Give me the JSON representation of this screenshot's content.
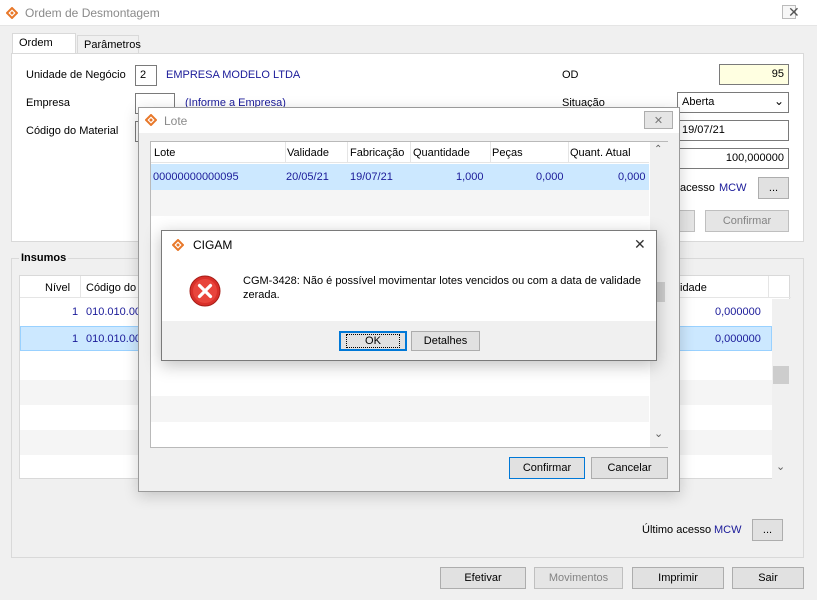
{
  "window": {
    "title": "Ordem de Desmontagem"
  },
  "tabs": [
    {
      "label": "Ordem"
    },
    {
      "label": "Parâmetros"
    }
  ],
  "form": {
    "unidade_label": "Unidade de Negócio",
    "unidade_code": "2",
    "unidade_name": "EMPRESA MODELO LTDA",
    "empresa_label": "Empresa",
    "empresa_hint": "(Informe a Empresa)",
    "codigo_material_label": "Código do Material",
    "od_label": "OD",
    "od_value": "95",
    "situacao_label": "Situação",
    "situacao_value": "Aberta",
    "date_value": "19/07/21",
    "quantity_value": "100,000000",
    "ultimo_acesso_label": "Último acesso",
    "ultimo_acesso_partial": "acesso",
    "ultimo_acesso_user": "MCW",
    "ellipsis": "...",
    "confirmar_label": "Confirmar"
  },
  "insumos": {
    "title": "Insumos",
    "columns": {
      "nivel": "Nível",
      "codigo": "Código do",
      "quantidade": "idade"
    },
    "rows": [
      {
        "nivel": "1",
        "codigo": "010.010.00",
        "quantidade": "0,000000"
      },
      {
        "nivel": "1",
        "codigo": "010.010.00",
        "quantidade": "0,000000"
      }
    ],
    "ultimo_acesso_label": "Último acesso",
    "ultimo_acesso_user": "MCW",
    "ellipsis": "..."
  },
  "footer": {
    "efetivar": "Efetivar",
    "movimentos": "Movimentos",
    "imprimir": "Imprimir",
    "sair": "Sair"
  },
  "lote_dialog": {
    "title": "Lote",
    "columns": [
      "Lote",
      "Validade",
      "Fabricação",
      "Quantidade",
      "Peças",
      "Quant. Atual"
    ],
    "rows": [
      {
        "lote": "00000000000095",
        "validade": "20/05/21",
        "fabricacao": "19/07/21",
        "quantidade": "1,000",
        "pecas": "0,000",
        "quant_atual": "0,000"
      }
    ],
    "confirmar": "Confirmar",
    "cancelar": "Cancelar"
  },
  "message_box": {
    "title": "CIGAM",
    "message_line1": "CGM-3428: Não é possível movimentar lotes vencidos ou com a data de validade",
    "message_line2": "zerada.",
    "ok": "OK",
    "detalhes": "Detalhes"
  },
  "colors": {
    "selection": "#cce8ff",
    "accent_blue": "#1a1a99",
    "error_red": "#d9302a",
    "od_field": "#ffffe1"
  }
}
